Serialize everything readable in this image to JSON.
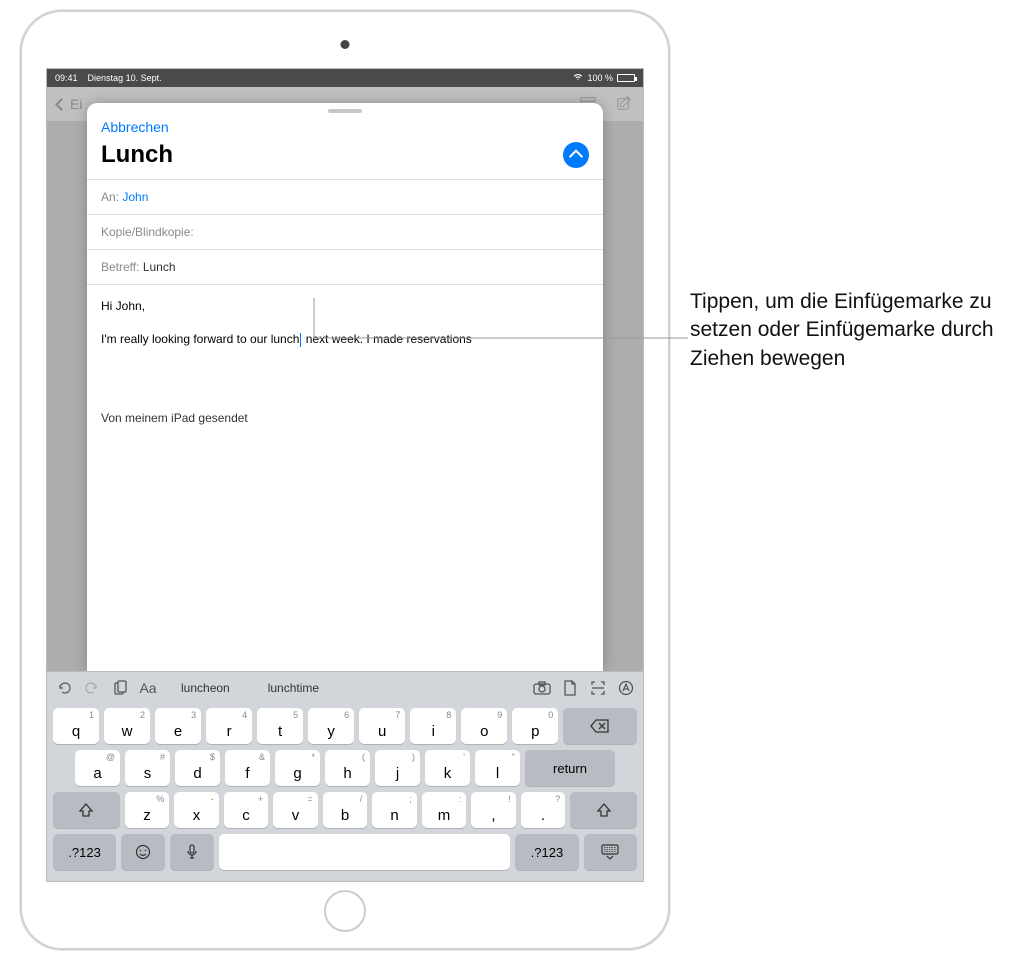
{
  "statusbar": {
    "time": "09:41",
    "date": "Dienstag 10. Sept.",
    "battery": "100 %",
    "wifi_icon": "wifi"
  },
  "background_nav": {
    "back_label": "Ei",
    "archive_icon": "archive",
    "compose_icon": "compose"
  },
  "compose": {
    "cancel": "Abbrechen",
    "title": "Lunch",
    "to_label": "An:",
    "to_value": "John",
    "cc_label": "Kopie/Blindkopie:",
    "subject_label": "Betreff:",
    "subject_value": "Lunch",
    "body_greeting": "Hi John,",
    "body_before_cursor": "I'm really looking forward to our lunch",
    "body_after_cursor": " next week. I made reservations",
    "signature": "Von meinem iPad gesendet"
  },
  "keyboard": {
    "suggestions": [
      "luncheon",
      "lunchtime"
    ],
    "format_label": "Aa",
    "row1": [
      {
        "m": "q",
        "s": "1"
      },
      {
        "m": "w",
        "s": "2"
      },
      {
        "m": "e",
        "s": "3"
      },
      {
        "m": "r",
        "s": "4"
      },
      {
        "m": "t",
        "s": "5"
      },
      {
        "m": "y",
        "s": "6"
      },
      {
        "m": "u",
        "s": "7"
      },
      {
        "m": "i",
        "s": "8"
      },
      {
        "m": "o",
        "s": "9"
      },
      {
        "m": "p",
        "s": "0"
      }
    ],
    "row2": [
      {
        "m": "a",
        "s": "@"
      },
      {
        "m": "s",
        "s": "#"
      },
      {
        "m": "d",
        "s": "$"
      },
      {
        "m": "f",
        "s": "&"
      },
      {
        "m": "g",
        "s": "*"
      },
      {
        "m": "h",
        "s": "("
      },
      {
        "m": "j",
        "s": ")"
      },
      {
        "m": "k",
        "s": "'"
      },
      {
        "m": "l",
        "s": "\""
      }
    ],
    "row3": [
      {
        "m": "z",
        "s": "%"
      },
      {
        "m": "x",
        "s": "-"
      },
      {
        "m": "c",
        "s": "+"
      },
      {
        "m": "v",
        "s": "="
      },
      {
        "m": "b",
        "s": "/"
      },
      {
        "m": "n",
        "s": ";"
      },
      {
        "m": "m",
        "s": ":"
      },
      {
        "m": ",",
        "s": "!"
      },
      {
        "m": ".",
        "s": "?"
      }
    ],
    "delete": "⌫",
    "return": "return",
    "numkey": ".?123",
    "icons": {
      "undo": "undo",
      "redo": "redo",
      "clipboard": "clipboard",
      "camera": "camera",
      "doc": "document",
      "scan": "scan",
      "markup": "markup",
      "emoji": "emoji",
      "mic": "mic",
      "dismiss": "keyboard-dismiss"
    }
  },
  "callout": {
    "text": "Tippen, um die Einfügemarke zu setzen oder Einfügemarke durch Ziehen bewegen"
  }
}
